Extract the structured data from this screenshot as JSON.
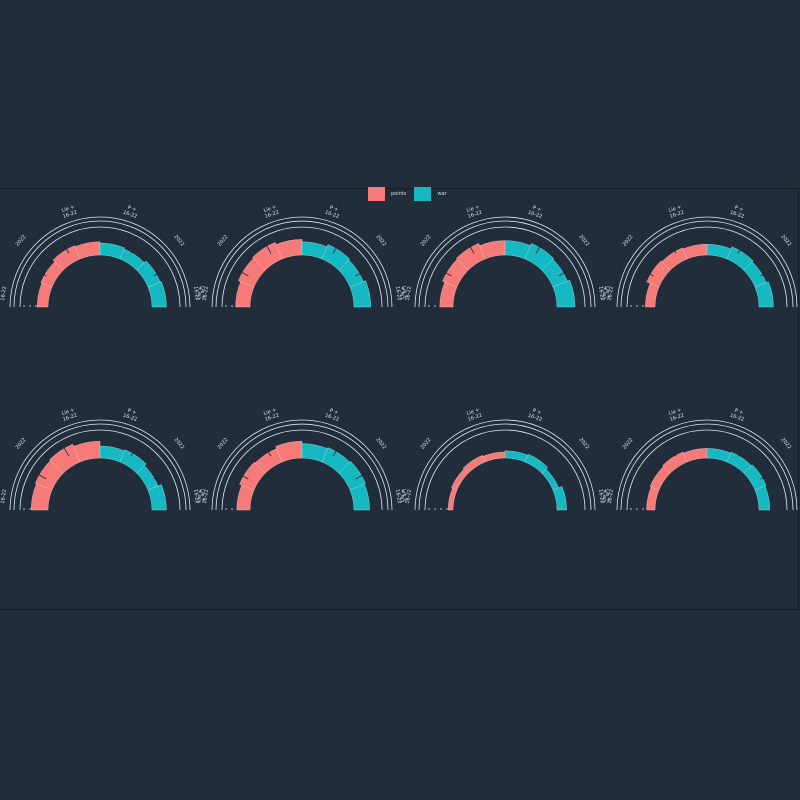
{
  "legend": [
    {
      "label": "points",
      "color": "#f57a78"
    },
    {
      "label": "war",
      "color": "#16b9c2"
    }
  ],
  "chart_data": {
    "type": "radial-bar",
    "layout": "2 rows x 4 columns of semicircular stacked radial bars",
    "category_labels": [
      "Lie +\n16-22",
      "2022",
      "Lie +\n16-22",
      "P +\n16-22",
      "2022",
      "Lie +\n16-22"
    ],
    "panels": [
      {
        "title": "",
        "rings": [
          0.25,
          0.4,
          0.55,
          0.7,
          0.85,
          1.0
        ],
        "points": [
          0.45,
          0.5,
          0.6,
          0.55
        ],
        "war": [
          0.5,
          0.45,
          0.55,
          0.6
        ]
      },
      {
        "title": "",
        "rings": [
          0.25,
          0.4,
          0.55,
          0.7,
          0.85,
          1.0
        ],
        "points": [
          0.6,
          0.7,
          0.75,
          0.65
        ],
        "war": [
          0.55,
          0.65,
          0.6,
          0.7
        ]
      },
      {
        "title": "",
        "rings": [
          0.25,
          0.4,
          0.55,
          0.7,
          0.85,
          1.0
        ],
        "points": [
          0.55,
          0.65,
          0.7,
          0.6
        ],
        "war": [
          0.6,
          0.7,
          0.65,
          0.75
        ]
      },
      {
        "title": "",
        "rings": [
          0.25,
          0.4,
          0.55,
          0.7,
          0.85,
          1.0
        ],
        "points": [
          0.4,
          0.55,
          0.5,
          0.45
        ],
        "war": [
          0.45,
          0.55,
          0.5,
          0.6
        ]
      },
      {
        "title": "",
        "rings": [
          0.25,
          0.4,
          0.55,
          0.7,
          0.85,
          1.0
        ],
        "points": [
          0.7,
          0.75,
          0.8,
          0.7
        ],
        "war": [
          0.5,
          0.55,
          0.45,
          0.6
        ]
      },
      {
        "title": "",
        "rings": [
          0.25,
          0.4,
          0.55,
          0.7,
          0.85,
          1.0
        ],
        "points": [
          0.55,
          0.65,
          0.6,
          0.7
        ],
        "war": [
          0.6,
          0.65,
          0.7,
          0.65
        ]
      },
      {
        "title": "",
        "rings": [
          0.25,
          0.4,
          0.55,
          0.7,
          0.85,
          1.0
        ],
        "points": [
          0.2,
          0.25,
          0.3,
          0.25
        ],
        "war": [
          0.3,
          0.35,
          0.25,
          0.4
        ]
      },
      {
        "title": "",
        "rings": [
          0.25,
          0.4,
          0.55,
          0.7,
          0.85,
          1.0
        ],
        "points": [
          0.35,
          0.4,
          0.45,
          0.4
        ],
        "war": [
          0.4,
          0.45,
          0.5,
          0.45
        ]
      }
    ]
  }
}
